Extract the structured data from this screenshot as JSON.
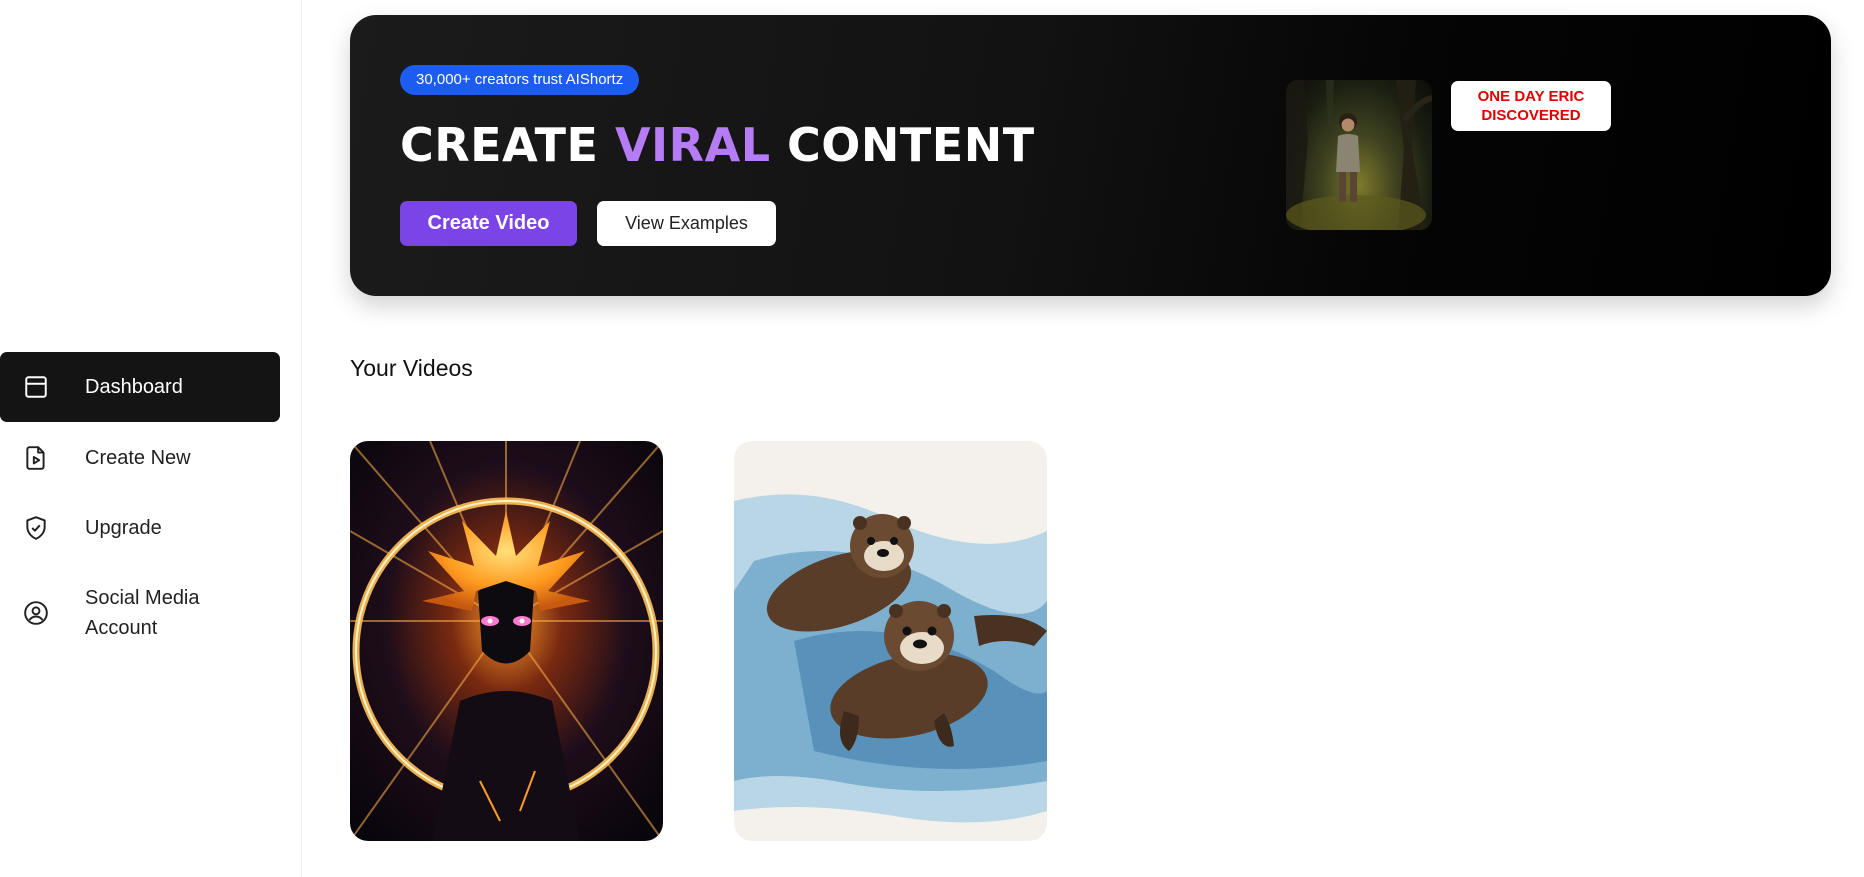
{
  "sidebar": {
    "items": [
      {
        "label": "Dashboard",
        "icon": "dashboard-icon",
        "active": true
      },
      {
        "label": "Create New",
        "icon": "file-play-icon",
        "active": false
      },
      {
        "label": "Upgrade",
        "icon": "shield-check-icon",
        "active": false
      },
      {
        "label": "Social Media Account",
        "icon": "user-circle-icon",
        "active": false
      }
    ]
  },
  "hero": {
    "badge": "30,000+ creators trust AIShortz",
    "title_part1": "CREATE ",
    "title_accent": "VIRAL",
    "title_part2": " CONTENT",
    "create_button": "Create Video",
    "examples_button": "View Examples",
    "caption": "ONE DAY ERIC DISCOVERED"
  },
  "videos": {
    "title": "Your Videos",
    "items": [
      {
        "thumbnail": "anime-glowing-character"
      },
      {
        "thumbnail": "watercolor-sea-otters"
      }
    ]
  },
  "colors": {
    "accent_purple": "#7b44e6",
    "title_accent": "#b57cf5",
    "badge_blue": "#1d5cf0",
    "caption_red": "#e00000",
    "active_nav": "#141414"
  }
}
